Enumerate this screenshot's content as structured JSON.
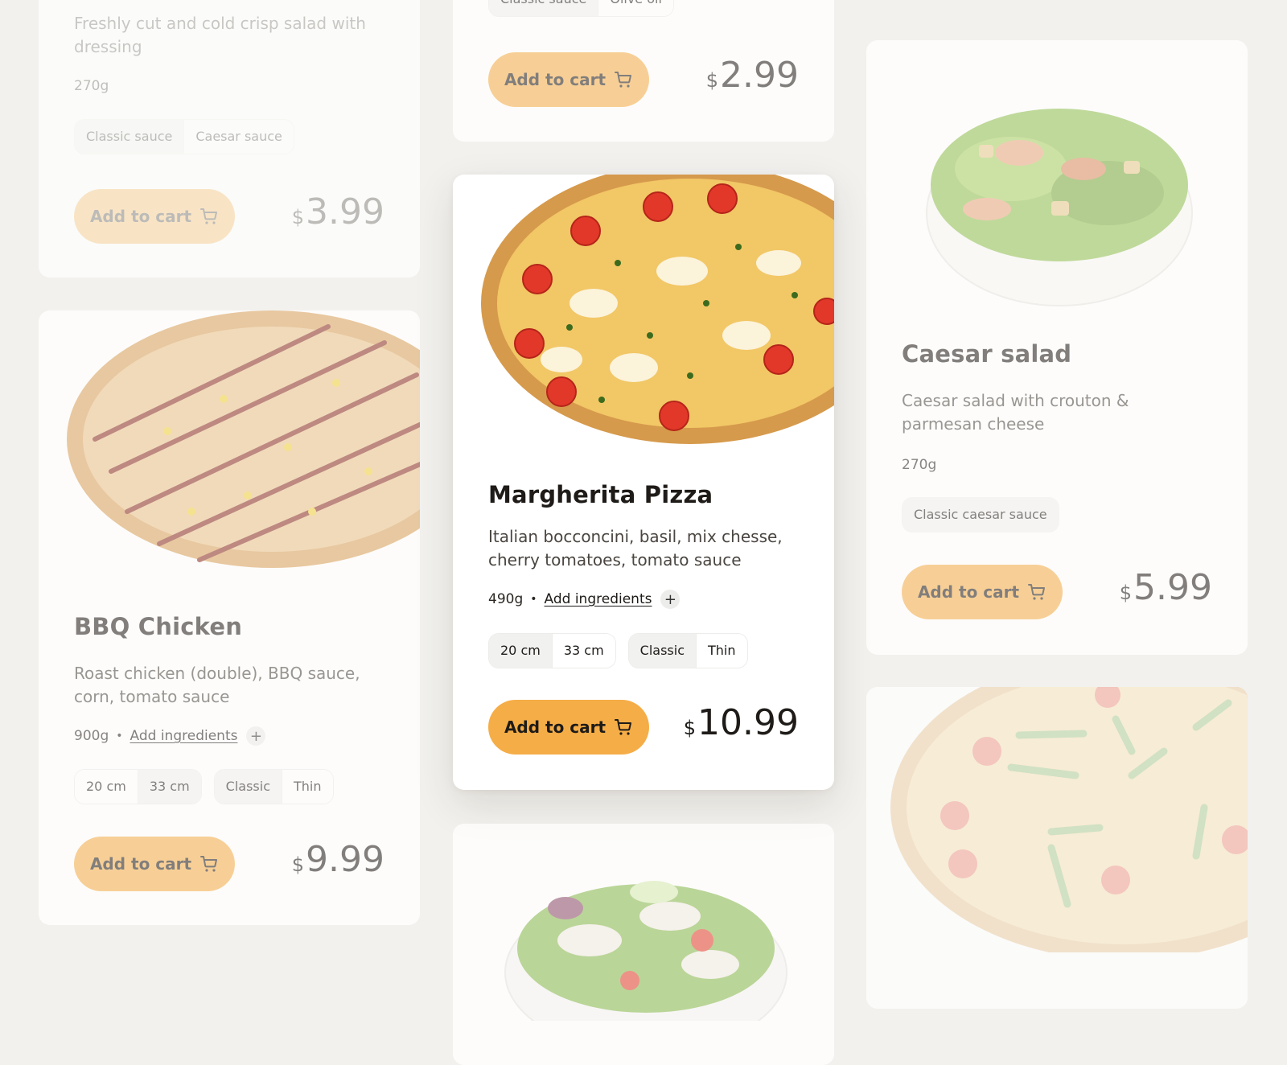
{
  "colors": {
    "accent": "#f5ad47",
    "page_background": "#f2f1ee",
    "card_background": "#ffffff",
    "text_primary": "#1e1b18",
    "chip_selected": "#f1f1ef"
  },
  "cart_button_label": "Add to cart",
  "cart_icon": "shopping-cart-icon",
  "add_icon": "plus-icon",
  "products": {
    "fresh_salad": {
      "description": "Freshly cut and cold crisp salad with dressing",
      "weight": "270g",
      "options": [
        "Classic sauce",
        "Caesar sauce"
      ],
      "selected_option": "Classic sauce",
      "currency": "$",
      "price": "3.99"
    },
    "salad_top_middle": {
      "options": [
        "Classic sauce",
        "Olive oil"
      ],
      "selected_option": "Classic sauce",
      "currency": "$",
      "price": "2.99"
    },
    "caesar_salad": {
      "title": "Caesar salad",
      "description": "Caesar salad with crouton & parmesan cheese",
      "weight": "270g",
      "options": [
        "Classic caesar sauce"
      ],
      "selected_option": "Classic caesar sauce",
      "currency": "$",
      "price": "5.99"
    },
    "margherita": {
      "title": "Margherita Pizza",
      "description": "Italian bocconcini, basil, mix chesse, cherry tomatoes, tomato sauce",
      "weight": "490g",
      "separator": "•",
      "add_ingredients_label": "Add ingredients",
      "sizes": [
        "20 cm",
        "33 cm"
      ],
      "selected_size": "20 cm",
      "crusts": [
        "Classic",
        "Thin"
      ],
      "selected_crust": "Classic",
      "currency": "$",
      "price": "10.99"
    },
    "bbq_chicken": {
      "title": "BBQ Chicken",
      "description": "Roast chicken (double), BBQ sauce, corn, tomato sauce",
      "weight": "900g",
      "separator": "•",
      "add_ingredients_label": "Add ingredients",
      "sizes": [
        "20 cm",
        "33 cm"
      ],
      "selected_size": "33 cm",
      "crusts": [
        "Classic",
        "Thin"
      ],
      "selected_crust": "Classic",
      "currency": "$",
      "price": "9.99"
    }
  }
}
